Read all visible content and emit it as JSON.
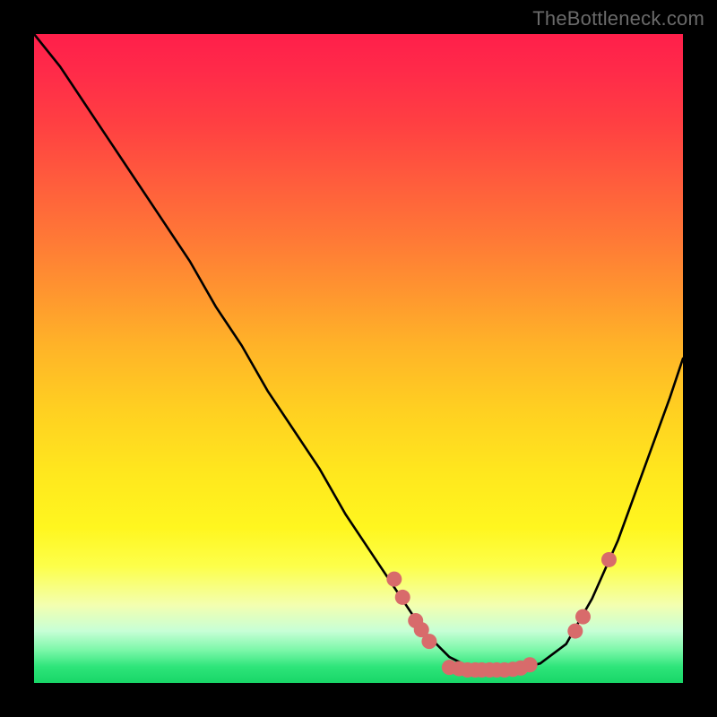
{
  "watermark": "TheBottleneck.com",
  "colors": {
    "background": "#000000",
    "dot": "#d86b6b",
    "curve": "#000000",
    "gradient_top": "#ff1f4a",
    "gradient_bottom": "#18d668"
  },
  "chart_data": {
    "type": "line",
    "title": "",
    "xlabel": "",
    "ylabel": "",
    "xlim": [
      0,
      100
    ],
    "ylim": [
      0,
      100
    ],
    "curve": {
      "x": [
        0,
        4,
        8,
        12,
        16,
        20,
        24,
        28,
        32,
        36,
        40,
        44,
        48,
        52,
        56,
        60,
        62,
        64,
        66,
        68,
        70,
        72,
        74,
        78,
        82,
        86,
        90,
        94,
        98,
        100
      ],
      "y": [
        100,
        95,
        89,
        83,
        77,
        71,
        65,
        58,
        52,
        45,
        39,
        33,
        26,
        20,
        14,
        8,
        6,
        4,
        3,
        2,
        2,
        2,
        2,
        3,
        6,
        13,
        22,
        33,
        44,
        50
      ]
    },
    "series": [
      {
        "name": "points-left-cluster",
        "x": [
          55.5,
          56.8,
          58.8,
          59.7,
          60.9
        ],
        "y": [
          16.0,
          13.2,
          9.6,
          8.2,
          6.4
        ]
      },
      {
        "name": "points-bottom-cluster",
        "x": [
          64.0,
          65.5,
          66.8,
          68.0,
          69.0,
          70.2,
          71.3,
          72.5,
          73.8,
          75.0,
          76.4
        ],
        "y": [
          2.4,
          2.2,
          2.0,
          2.0,
          2.0,
          2.0,
          2.0,
          2.0,
          2.1,
          2.3,
          2.8
        ]
      },
      {
        "name": "points-right-cluster",
        "x": [
          83.4,
          84.6,
          88.6
        ],
        "y": [
          8.0,
          10.2,
          19.0
        ]
      }
    ],
    "annotations": []
  }
}
